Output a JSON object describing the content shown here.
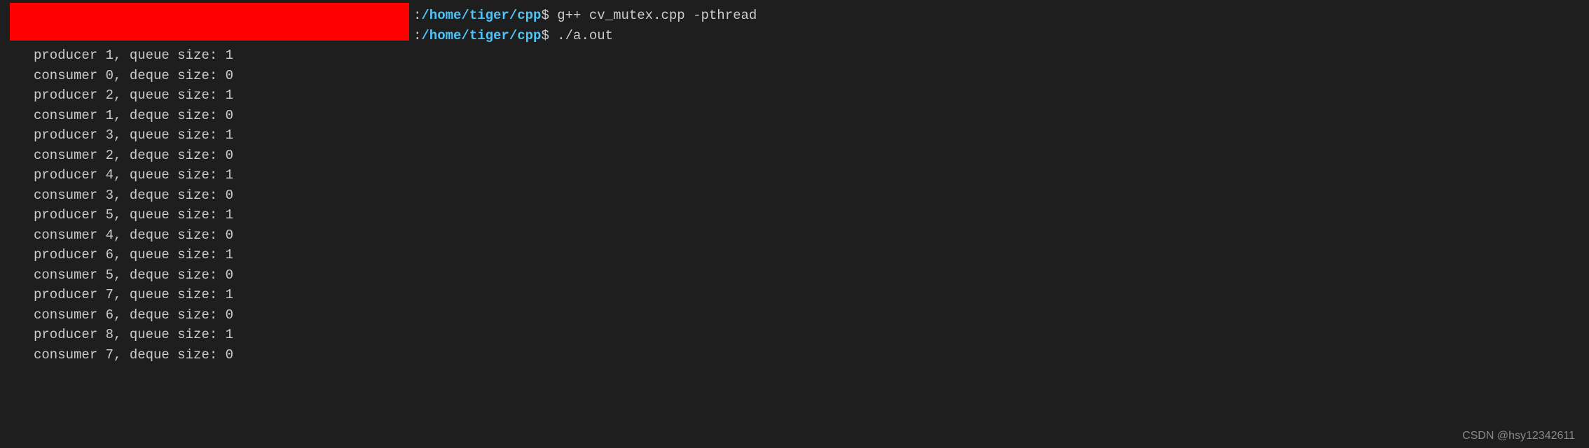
{
  "prompt": {
    "colon": ":",
    "path": "/home/tiger/cpp",
    "dollar": "$",
    "cmd1": "g++ cv_mutex.cpp -pthread",
    "cmd2": "./a.out"
  },
  "output": [
    "producer 1, queue size: 1",
    "consumer 0, deque size: 0",
    "producer 2, queue size: 1",
    "consumer 1, deque size: 0",
    "producer 3, queue size: 1",
    "consumer 2, deque size: 0",
    "producer 4, queue size: 1",
    "consumer 3, deque size: 0",
    "producer 5, queue size: 1",
    "consumer 4, deque size: 0",
    "producer 6, queue size: 1",
    "consumer 5, deque size: 0",
    "producer 7, queue size: 1",
    "consumer 6, deque size: 0",
    "producer 8, queue size: 1",
    "consumer 7, deque size: 0"
  ],
  "watermark": "CSDN @hsy12342611"
}
